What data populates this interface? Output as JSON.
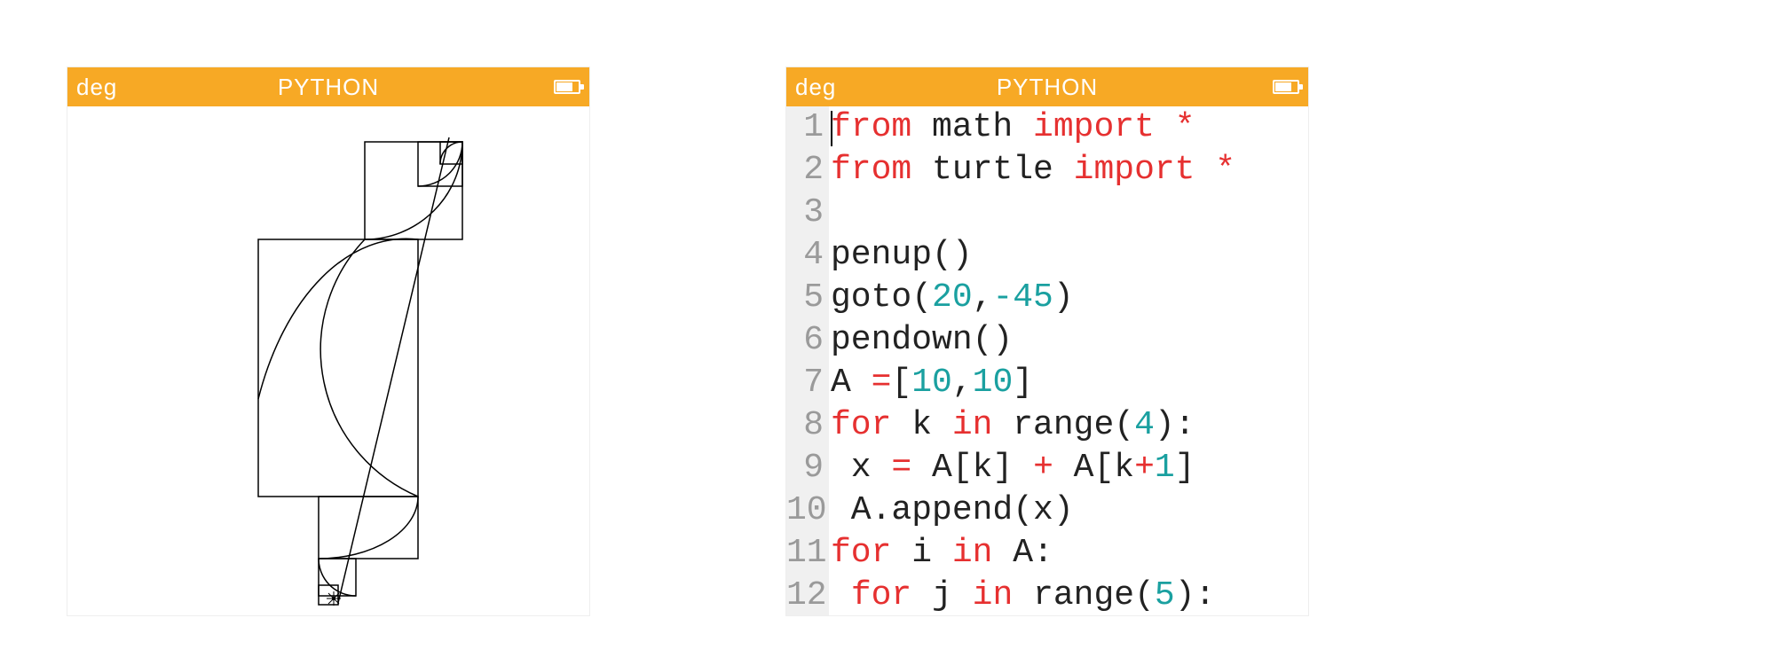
{
  "colors": {
    "header_bg": "#f7a925",
    "header_fg": "#ffffff",
    "keyword": "#e63030",
    "number": "#1aa0a0",
    "gutter_bg": "#f0f0f0",
    "gutter_fg": "#9a9a9a"
  },
  "left_screen": {
    "titlebar": {
      "mode": "deg",
      "title": "PYTHON"
    }
  },
  "right_screen": {
    "titlebar": {
      "mode": "deg",
      "title": "PYTHON"
    },
    "code": {
      "lines": [
        {
          "n": "1",
          "tokens": [
            [
              "kw",
              "from"
            ],
            [
              "plain",
              " math "
            ],
            [
              "kw",
              "import"
            ],
            [
              "plain",
              " "
            ],
            [
              "op",
              "*"
            ]
          ]
        },
        {
          "n": "2",
          "tokens": [
            [
              "kw",
              "from"
            ],
            [
              "plain",
              " turtle "
            ],
            [
              "kw",
              "import"
            ],
            [
              "plain",
              " "
            ],
            [
              "op",
              "*"
            ]
          ]
        },
        {
          "n": "3",
          "tokens": []
        },
        {
          "n": "4",
          "tokens": [
            [
              "plain",
              "penup()"
            ]
          ]
        },
        {
          "n": "5",
          "tokens": [
            [
              "plain",
              "goto("
            ],
            [
              "num",
              "20"
            ],
            [
              "plain",
              ","
            ],
            [
              "num",
              "-45"
            ],
            [
              "plain",
              ")"
            ]
          ]
        },
        {
          "n": "6",
          "tokens": [
            [
              "plain",
              "pendown()"
            ]
          ]
        },
        {
          "n": "7",
          "tokens": [
            [
              "plain",
              "A "
            ],
            [
              "op",
              "="
            ],
            [
              "plain",
              "["
            ],
            [
              "num",
              "10"
            ],
            [
              "plain",
              ","
            ],
            [
              "num",
              "10"
            ],
            [
              "plain",
              "]"
            ]
          ]
        },
        {
          "n": "8",
          "tokens": [
            [
              "kw",
              "for"
            ],
            [
              "plain",
              " k "
            ],
            [
              "kw",
              "in"
            ],
            [
              "plain",
              " range("
            ],
            [
              "num",
              "4"
            ],
            [
              "plain",
              "):"
            ]
          ]
        },
        {
          "n": "9",
          "tokens": [
            [
              "plain",
              " x "
            ],
            [
              "op",
              "="
            ],
            [
              "plain",
              " A[k] "
            ],
            [
              "op",
              "+"
            ],
            [
              "plain",
              " A[k"
            ],
            [
              "op",
              "+"
            ],
            [
              "num",
              "1"
            ],
            [
              "plain",
              "]"
            ]
          ]
        },
        {
          "n": "10",
          "tokens": [
            [
              "plain",
              " A.append(x)"
            ]
          ]
        },
        {
          "n": "11",
          "tokens": [
            [
              "kw",
              "for"
            ],
            [
              "plain",
              " i "
            ],
            [
              "kw",
              "in"
            ],
            [
              "plain",
              " A:"
            ]
          ]
        },
        {
          "n": "12",
          "tokens": [
            [
              "plain",
              " "
            ],
            [
              "kw",
              "for"
            ],
            [
              "plain",
              " j "
            ],
            [
              "kw",
              "in"
            ],
            [
              "plain",
              " range("
            ],
            [
              "num",
              "5"
            ],
            [
              "plain",
              "):"
            ]
          ]
        }
      ]
    }
  }
}
